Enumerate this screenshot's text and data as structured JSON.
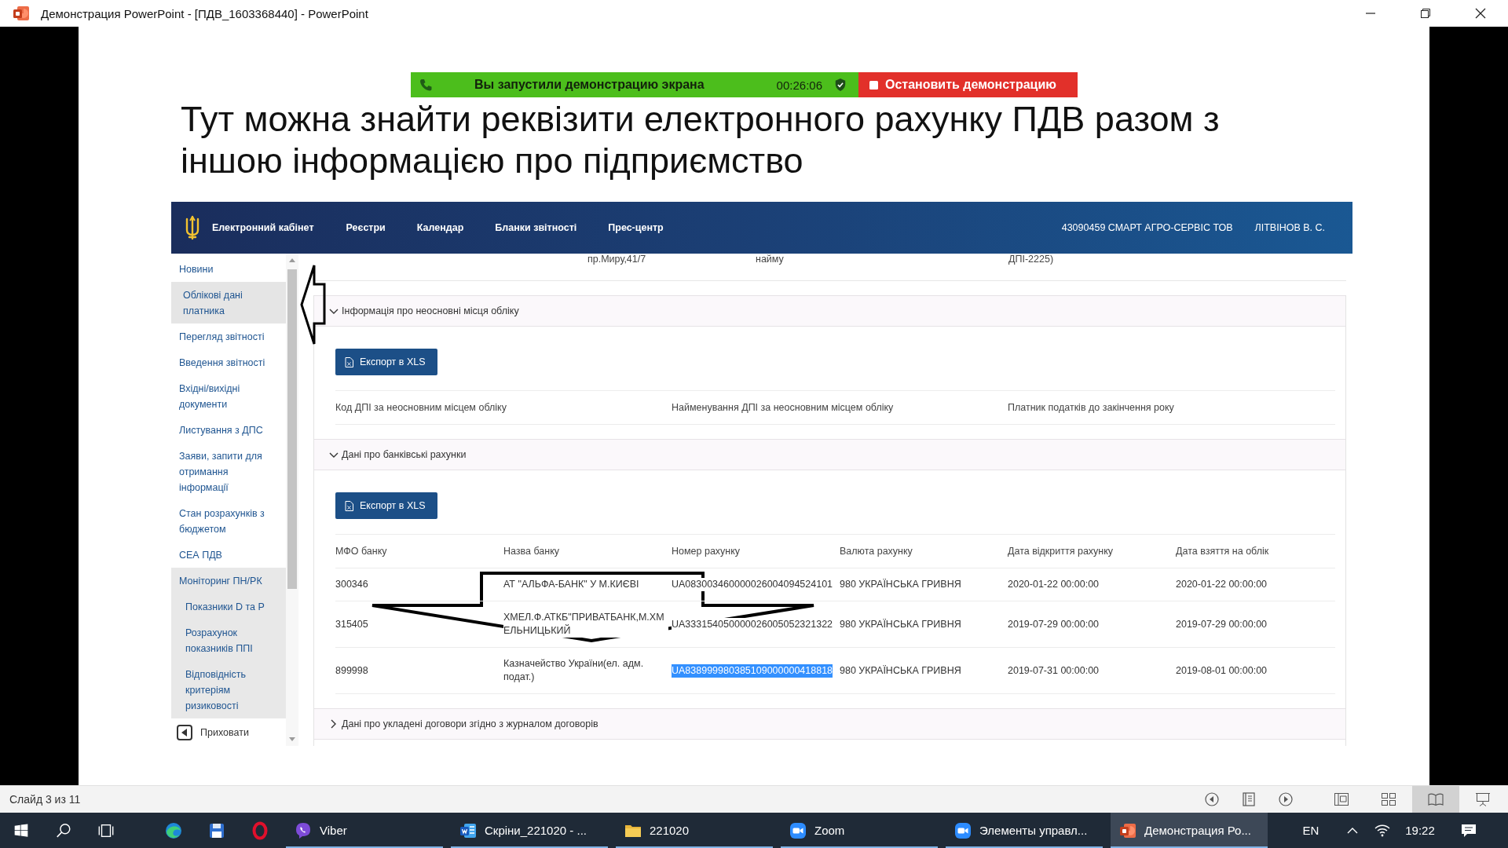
{
  "window": {
    "title": "Демонстрация PowerPoint - [ПДВ_1603368440] - PowerPoint"
  },
  "share_banner": {
    "message": "Вы запустили демонстрацию экрана",
    "timer": "00:26:06",
    "stop_button": "Остановить демонстрацию"
  },
  "slide": {
    "heading": "Тут можна знайти реквізити електронного рахунку ПДВ разом з іншою інформацією про підприємство",
    "portal": {
      "nav": {
        "brand": "Електронний кабінет",
        "items": [
          "Реєстри",
          "Календар",
          "Бланки звітності",
          "Прес-центр"
        ],
        "company": "43090459 СМАРТ АГРО-СЕРВІС ТОВ",
        "user": "ЛІТВІНОВ В. С."
      },
      "sidebar": {
        "items": [
          {
            "label": "Новини",
            "selected": false,
            "expanded": false
          },
          {
            "label": "Облікові дані платника",
            "selected": true,
            "expanded": false
          },
          {
            "label": "Перегляд звітності",
            "selected": false,
            "expanded": false
          },
          {
            "label": "Введення звітності",
            "selected": false,
            "expanded": false
          },
          {
            "label": "Вхідні/вихідні документи",
            "selected": false,
            "expanded": false
          },
          {
            "label": "Листування з ДПС",
            "selected": false,
            "expanded": false
          },
          {
            "label": "Заяви, запити для отримання інформації",
            "selected": false,
            "expanded": false
          },
          {
            "label": "Стан розрахунків з бюджетом",
            "selected": false,
            "expanded": false
          },
          {
            "label": "СЕА ПДВ",
            "selected": false,
            "expanded": false
          },
          {
            "label": "Моніторинг ПН/РК",
            "selected": false,
            "expanded": true,
            "children": [
              {
                "label": "Показники D та P",
                "selected": false
              },
              {
                "label": "Розрахунок показників ППІ",
                "selected": false
              },
              {
                "label": "Відповідність критеріям ризиковості",
                "selected": false
              }
            ]
          }
        ],
        "hide_button": "Приховати"
      },
      "previous_row": [
        "пр.Миру,41/7",
        "найму",
        "ДПІ-2225)"
      ],
      "sections": [
        {
          "title": "Інформація про неосновні місця обліку",
          "expanded": true,
          "export_button": "Експорт в XLS",
          "columns": [
            "Код ДПІ за неосновним місцем обліку",
            "Найменування ДПІ за неосновним місцем обліку",
            "Платник податків до закінчення року"
          ]
        },
        {
          "title": "Дані про банківські рахунки",
          "expanded": true,
          "export_button": "Експорт в XLS",
          "columns": [
            "МФО банку",
            "Назва банку",
            "Номер рахунку",
            "Валюта рахунку",
            "Дата відкриття рахунку",
            "Дата взяття на облік"
          ],
          "rows": [
            {
              "mfo": "300346",
              "bank": "АТ \"АЛЬФА-БАНК\" У М.КИЄВІ",
              "account": "UA083003460000026004094524101",
              "account_selected": false,
              "currency": "980 УКРАЇНСЬКА ГРИВНЯ",
              "opened": "2020-01-22 00:00:00",
              "registered": "2020-01-22 00:00:00"
            },
            {
              "mfo": "315405",
              "bank": "ХМЕЛ.Ф.АТКБ\"ПРИВАТБАНК,М.ХМЕЛЬНИЦЬКИЙ",
              "account": "UA333154050000026005052321322",
              "account_selected": false,
              "currency": "980 УКРАЇНСЬКА ГРИВНЯ",
              "opened": "2019-07-29 00:00:00",
              "registered": "2019-07-29 00:00:00"
            },
            {
              "mfo": "899998",
              "bank": "Казначейство України(ел. адм. подат.)",
              "account": "UA838999980385109000000418818",
              "account_selected": true,
              "currency": "980 УКРАЇНСЬКА ГРИВНЯ",
              "opened": "2019-07-31 00:00:00",
              "registered": "2019-08-01 00:00:00"
            }
          ]
        },
        {
          "title": "Дані про укладені договори згідно з журналом договорів",
          "expanded": false
        }
      ]
    }
  },
  "status_bar": {
    "slide_counter": "Слайд 3 из 11",
    "views": [
      {
        "kind": "normal",
        "selected": false
      },
      {
        "kind": "sorter",
        "selected": false
      },
      {
        "kind": "reading",
        "selected": true
      },
      {
        "kind": "slideshow",
        "selected": false
      }
    ]
  },
  "taskbar": {
    "apps": [
      {
        "kind": "edge",
        "running": false,
        "active": false
      },
      {
        "kind": "save",
        "running": false,
        "active": false
      },
      {
        "kind": "opera",
        "running": false,
        "active": false
      },
      {
        "kind": "viber",
        "label": "Viber",
        "running": true,
        "active": false
      },
      {
        "kind": "word",
        "label": "Скріни_221020 - ...",
        "running": true,
        "active": false
      },
      {
        "kind": "folder",
        "label": "221020",
        "running": true,
        "active": false
      },
      {
        "kind": "zoom",
        "label": "Zoom",
        "running": true,
        "active": false
      },
      {
        "kind": "zoom",
        "label": "Элементы управл...",
        "running": true,
        "active": false
      },
      {
        "kind": "powerpoint",
        "label": "Демонстрация Ро...",
        "running": true,
        "active": true
      }
    ],
    "language": "EN",
    "time": "19:22"
  }
}
